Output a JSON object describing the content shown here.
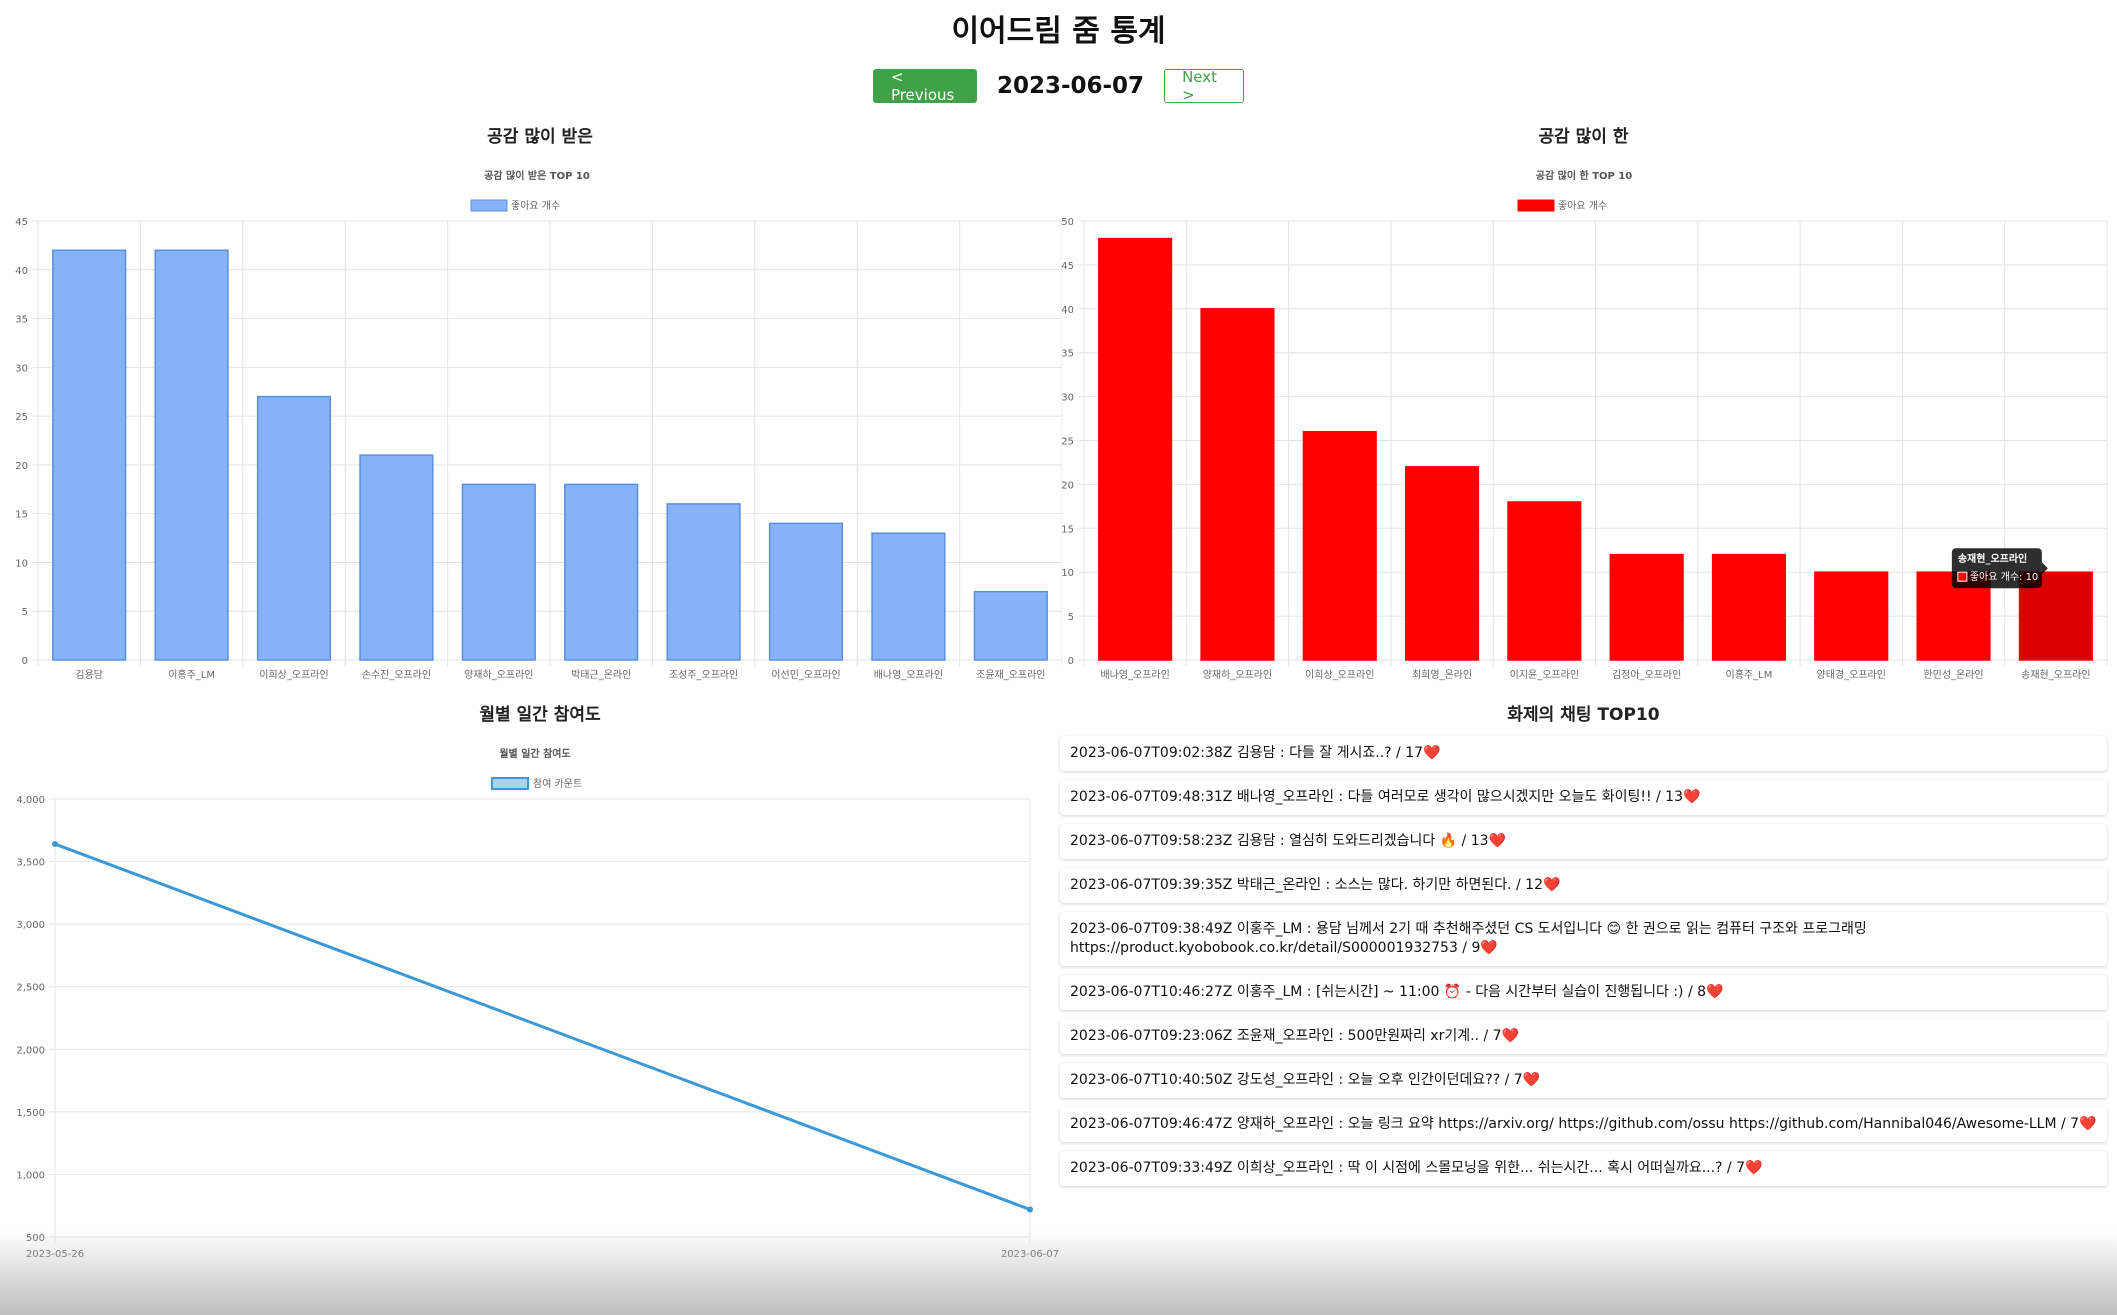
{
  "page": {
    "title": "이어드림 줌 통계",
    "prev_label": "< Previous",
    "next_label": "Next >",
    "date": "2023-06-07"
  },
  "panels": {
    "received_title": "공감 많이 받은",
    "given_title": "공감 많이 한",
    "monthly_title": "월별 일간 참여도",
    "chat_title": "화제의 채팅 TOP10"
  },
  "chart_data": [
    {
      "type": "bar",
      "title": "공감 많이 받은 TOP 10",
      "legend": "top",
      "grid": true,
      "ylim": [
        0,
        45
      ],
      "yticks": [
        0,
        5,
        10,
        15,
        20,
        25,
        30,
        35,
        40,
        45
      ],
      "categories": [
        "김용담",
        "이홍주_LM",
        "이희상_오프라인",
        "손수진_오프라인",
        "양재하_오프라인",
        "박태근_온라인",
        "조성주_오프라인",
        "이선민_오프라인",
        "배나영_오프라인",
        "조윤재_오프라인"
      ],
      "series": [
        {
          "name": "좋아요 개수",
          "color": "#86b3f8",
          "border": "#5a8fe0",
          "values": [
            42,
            42,
            27,
            21,
            18,
            18,
            16,
            14,
            13,
            7
          ]
        }
      ]
    },
    {
      "type": "bar",
      "title": "공감 많이 한 TOP 10",
      "legend": "top",
      "grid": true,
      "ylim": [
        0,
        50
      ],
      "yticks": [
        0,
        5,
        10,
        15,
        20,
        25,
        30,
        35,
        40,
        45,
        50
      ],
      "categories": [
        "배나영_오프라인",
        "양재하_오프라인",
        "이희상_오프라인",
        "최희영_온라인",
        "이지윤_오프라인",
        "김정아_오프라인",
        "이홍주_LM",
        "양태경_오프라인",
        "한민성_온라인",
        "송재현_오프라인"
      ],
      "series": [
        {
          "name": "좋아요 개수",
          "color": "#ff0000",
          "border": "#ff0000",
          "values": [
            48,
            40,
            26,
            22,
            18,
            12,
            12,
            10,
            10,
            10
          ]
        }
      ],
      "tooltip": {
        "title": "송재현_오프라인",
        "body": "좋아요 개수: 10"
      }
    },
    {
      "type": "line",
      "title": "월별 일간 참여도",
      "legend": "top",
      "grid": true,
      "ylim": [
        500,
        4000
      ],
      "yticks": [
        "500",
        "1,000",
        "1,500",
        "2,000",
        "2,500",
        "3,000",
        "3,500",
        "4,000"
      ],
      "x": [
        "2023-05-26",
        "2023-06-07"
      ],
      "series": [
        {
          "name": "참여 카운트",
          "color": "#3d98d6",
          "values": [
            3640,
            720
          ]
        }
      ]
    }
  ],
  "chats": [
    {
      "text": "2023-06-07T09:02:38Z 김용담 : 다들 잘 게시죠..? / 17",
      "heart": "❤️"
    },
    {
      "text": "2023-06-07T09:48:31Z 배나영_오프라인 : 다들 여러모로 생각이 많으시겠지만 오늘도 화이팅!! / 13",
      "heart": "❤️"
    },
    {
      "text": "2023-06-07T09:58:23Z 김용담 : 열심히 도와드리겠습니다 🔥 / 13",
      "heart": "❤️"
    },
    {
      "text": "2023-06-07T09:39:35Z 박태근_온라인 : 소스는 많다. 하기만 하면된다. / 12",
      "heart": "❤️"
    },
    {
      "text": "2023-06-07T09:38:49Z 이홍주_LM : 용담 님께서 2기 때 추천해주셨던 CS 도서입니다 😊 한 권으로 읽는 컴퓨터 구조와 프로그래밍 https://product.kyobobook.co.kr/detail/S000001932753 / 9",
      "heart": "❤️"
    },
    {
      "text": "2023-06-07T10:46:27Z 이홍주_LM : [쉬는시간] ~ 11:00 ⏰ - 다음 시간부터 실습이 진행됩니다 :) / 8",
      "heart": "❤️"
    },
    {
      "text": "2023-06-07T09:23:06Z 조윤재_오프라인 : 500만원짜리 xr기계.. / 7",
      "heart": "❤️"
    },
    {
      "text": "2023-06-07T10:40:50Z 강도성_오프라인 : 오늘 오후 인간이던데요?? / 7",
      "heart": "❤️"
    },
    {
      "text": "2023-06-07T09:46:47Z 양재하_오프라인 : 오늘 링크 요약 https://arxiv.org/ https://github.com/ossu https://github.com/Hannibal046/Awesome-LLM / 7",
      "heart": "❤️"
    },
    {
      "text": "2023-06-07T09:33:49Z 이희상_오프라인 : 딱 이 시점에 스몰모닝을 위한... 쉬는시간... 혹시 어떠실까요...? / 7",
      "heart": "❤️"
    }
  ]
}
